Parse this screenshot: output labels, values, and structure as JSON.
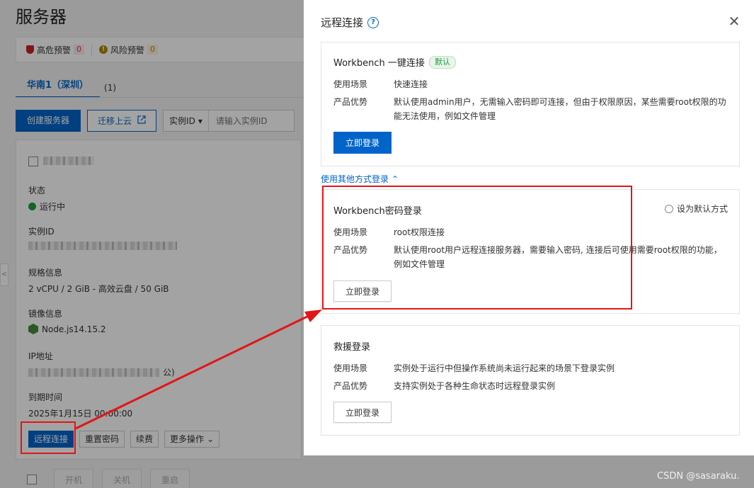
{
  "page": {
    "title": "服务器",
    "alerts": {
      "high_label": "高危预警",
      "high_count": "0",
      "risk_label": "风险预警",
      "risk_count": "0"
    },
    "region_tab": {
      "label": "华南1（深圳）",
      "count": "(1)"
    },
    "toolbar": {
      "create_label": "创建服务器",
      "migrate_label": "迁移上云",
      "search_select": "实例ID",
      "search_placeholder": "请输入实例ID"
    },
    "card": {
      "status_label": "状态",
      "status_value": "运行中",
      "instance_label": "实例ID",
      "spec_label": "规格信息",
      "spec_value": "2 vCPU / 2 GiB - 高效云盘 / 50 GiB",
      "image_label": "镜像信息",
      "image_value": "Node.js14.15.2",
      "ip_label": "IP地址",
      "ip_suffix": "公)",
      "expire_label": "到期时间",
      "expire_value": "2025年1月15日 00:00:00",
      "actions": {
        "remote": "远程连接",
        "reset_password": "重置密码",
        "renew": "续费",
        "more": "更多操作"
      }
    },
    "bottom_actions": {
      "start": "开机",
      "stop": "关机",
      "restart": "重启"
    }
  },
  "drawer": {
    "title": "远程连接",
    "close_icon": "close-icon",
    "scenario_key": "使用场景",
    "advantage_key": "产品优势",
    "login_label": "立即登录",
    "workbench_one_click": {
      "title": "Workbench 一键连接",
      "tag": "默认",
      "scenario": "快速连接",
      "advantage": "默认使用admin用户，无需输入密码即可连接，但由于权限原因，某些需要root权限的功能无法使用，例如文件管理"
    },
    "other_methods_link": "使用其他方式登录",
    "workbench_password": {
      "title": "Workbench密码登录",
      "set_default": "设为默认方式",
      "scenario": "root权限连接",
      "advantage": "默认使用root用户远程连接服务器，需要输入密码, 连接后可使用需要root权限的功能，例如文件管理"
    },
    "rescue": {
      "title": "救援登录",
      "scenario": "实例处于运行中但操作系统尚未运行起来的场景下登录实例",
      "advantage": "支持实例处于各种生命状态时远程登录实例"
    }
  },
  "watermark": "CSDN @sasaraku.",
  "colors": {
    "accent": "#0064c8",
    "annotation_red": "#e21616",
    "success": "#1b9e3e"
  }
}
